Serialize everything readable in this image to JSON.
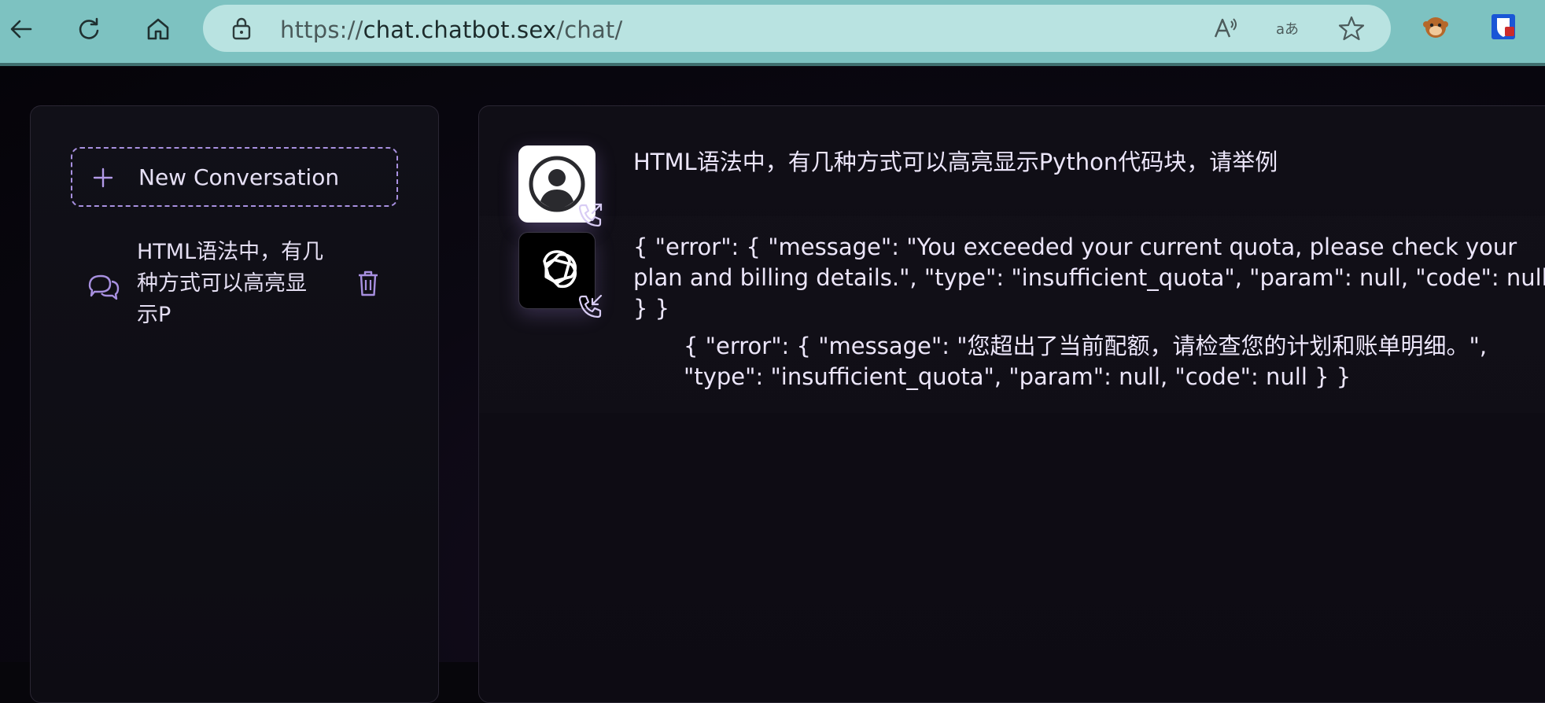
{
  "browser": {
    "url_prefix": "https://",
    "url_host": "chat.chatbot.sex",
    "url_path": "/chat/",
    "buttons": [
      "back-icon",
      "refresh-icon",
      "home-icon"
    ],
    "address_icons": [
      "read-aloud-icon",
      "translate-icon",
      "favorite-star-icon"
    ],
    "extensions": [
      "monkey-extension-icon",
      "bitwarden-extension-icon"
    ],
    "accent": "#7dc2c1"
  },
  "sidebar": {
    "new_conversation_label": "New Conversation",
    "conversations": [
      {
        "title": "HTML语法中，有几种方式可以高亮显示P"
      }
    ],
    "accent": "#a890e0"
  },
  "chat": {
    "messages": [
      {
        "role": "user",
        "text": "HTML语法中，有几种方式可以高亮显示Python代码块，请举例"
      },
      {
        "role": "assistant",
        "text": "{ \"error\": { \"message\": \"You exceeded your current quota, please check your plan and billing details.\", \"type\": \"insufficient_quota\", \"param\": null, \"code\": null } }",
        "translation": "{ \"error\": { \"message\": \"您超出了当前配额，请检查您的计划和账单明细。\", \"type\": \"insufficient_quota\", \"param\": null, \"code\": null } }"
      }
    ]
  }
}
